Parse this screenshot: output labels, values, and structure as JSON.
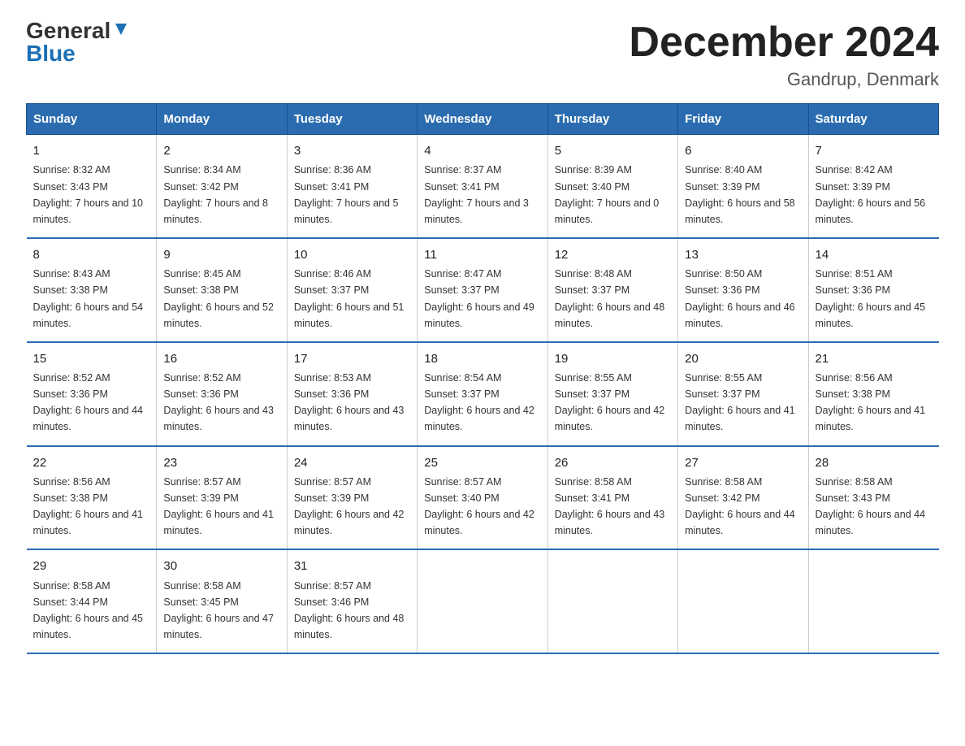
{
  "header": {
    "logo_general": "General",
    "logo_blue": "Blue",
    "title": "December 2024",
    "subtitle": "Gandrup, Denmark"
  },
  "days_of_week": [
    "Sunday",
    "Monday",
    "Tuesday",
    "Wednesday",
    "Thursday",
    "Friday",
    "Saturday"
  ],
  "weeks": [
    [
      {
        "num": "1",
        "sunrise": "8:32 AM",
        "sunset": "3:43 PM",
        "daylight": "7 hours and 10 minutes."
      },
      {
        "num": "2",
        "sunrise": "8:34 AM",
        "sunset": "3:42 PM",
        "daylight": "7 hours and 8 minutes."
      },
      {
        "num": "3",
        "sunrise": "8:36 AM",
        "sunset": "3:41 PM",
        "daylight": "7 hours and 5 minutes."
      },
      {
        "num": "4",
        "sunrise": "8:37 AM",
        "sunset": "3:41 PM",
        "daylight": "7 hours and 3 minutes."
      },
      {
        "num": "5",
        "sunrise": "8:39 AM",
        "sunset": "3:40 PM",
        "daylight": "7 hours and 0 minutes."
      },
      {
        "num": "6",
        "sunrise": "8:40 AM",
        "sunset": "3:39 PM",
        "daylight": "6 hours and 58 minutes."
      },
      {
        "num": "7",
        "sunrise": "8:42 AM",
        "sunset": "3:39 PM",
        "daylight": "6 hours and 56 minutes."
      }
    ],
    [
      {
        "num": "8",
        "sunrise": "8:43 AM",
        "sunset": "3:38 PM",
        "daylight": "6 hours and 54 minutes."
      },
      {
        "num": "9",
        "sunrise": "8:45 AM",
        "sunset": "3:38 PM",
        "daylight": "6 hours and 52 minutes."
      },
      {
        "num": "10",
        "sunrise": "8:46 AM",
        "sunset": "3:37 PM",
        "daylight": "6 hours and 51 minutes."
      },
      {
        "num": "11",
        "sunrise": "8:47 AM",
        "sunset": "3:37 PM",
        "daylight": "6 hours and 49 minutes."
      },
      {
        "num": "12",
        "sunrise": "8:48 AM",
        "sunset": "3:37 PM",
        "daylight": "6 hours and 48 minutes."
      },
      {
        "num": "13",
        "sunrise": "8:50 AM",
        "sunset": "3:36 PM",
        "daylight": "6 hours and 46 minutes."
      },
      {
        "num": "14",
        "sunrise": "8:51 AM",
        "sunset": "3:36 PM",
        "daylight": "6 hours and 45 minutes."
      }
    ],
    [
      {
        "num": "15",
        "sunrise": "8:52 AM",
        "sunset": "3:36 PM",
        "daylight": "6 hours and 44 minutes."
      },
      {
        "num": "16",
        "sunrise": "8:52 AM",
        "sunset": "3:36 PM",
        "daylight": "6 hours and 43 minutes."
      },
      {
        "num": "17",
        "sunrise": "8:53 AM",
        "sunset": "3:36 PM",
        "daylight": "6 hours and 43 minutes."
      },
      {
        "num": "18",
        "sunrise": "8:54 AM",
        "sunset": "3:37 PM",
        "daylight": "6 hours and 42 minutes."
      },
      {
        "num": "19",
        "sunrise": "8:55 AM",
        "sunset": "3:37 PM",
        "daylight": "6 hours and 42 minutes."
      },
      {
        "num": "20",
        "sunrise": "8:55 AM",
        "sunset": "3:37 PM",
        "daylight": "6 hours and 41 minutes."
      },
      {
        "num": "21",
        "sunrise": "8:56 AM",
        "sunset": "3:38 PM",
        "daylight": "6 hours and 41 minutes."
      }
    ],
    [
      {
        "num": "22",
        "sunrise": "8:56 AM",
        "sunset": "3:38 PM",
        "daylight": "6 hours and 41 minutes."
      },
      {
        "num": "23",
        "sunrise": "8:57 AM",
        "sunset": "3:39 PM",
        "daylight": "6 hours and 41 minutes."
      },
      {
        "num": "24",
        "sunrise": "8:57 AM",
        "sunset": "3:39 PM",
        "daylight": "6 hours and 42 minutes."
      },
      {
        "num": "25",
        "sunrise": "8:57 AM",
        "sunset": "3:40 PM",
        "daylight": "6 hours and 42 minutes."
      },
      {
        "num": "26",
        "sunrise": "8:58 AM",
        "sunset": "3:41 PM",
        "daylight": "6 hours and 43 minutes."
      },
      {
        "num": "27",
        "sunrise": "8:58 AM",
        "sunset": "3:42 PM",
        "daylight": "6 hours and 44 minutes."
      },
      {
        "num": "28",
        "sunrise": "8:58 AM",
        "sunset": "3:43 PM",
        "daylight": "6 hours and 44 minutes."
      }
    ],
    [
      {
        "num": "29",
        "sunrise": "8:58 AM",
        "sunset": "3:44 PM",
        "daylight": "6 hours and 45 minutes."
      },
      {
        "num": "30",
        "sunrise": "8:58 AM",
        "sunset": "3:45 PM",
        "daylight": "6 hours and 47 minutes."
      },
      {
        "num": "31",
        "sunrise": "8:57 AM",
        "sunset": "3:46 PM",
        "daylight": "6 hours and 48 minutes."
      },
      null,
      null,
      null,
      null
    ]
  ]
}
